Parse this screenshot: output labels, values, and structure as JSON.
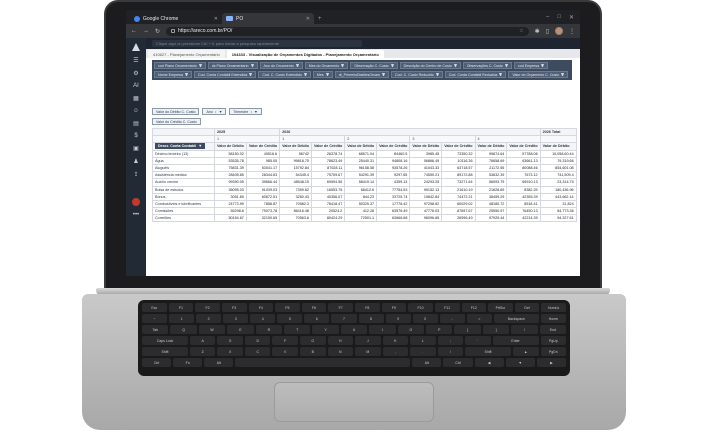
{
  "browser": {
    "tabs": [
      {
        "label": "Google Chrome"
      },
      {
        "label": "PO"
      }
    ],
    "url": "https://areco.com.br/PO/"
  },
  "app": {
    "search_placeholder": "Clique aqui ou pressione Ctrl + K para iniciar a pesquisa rapidamente",
    "crumbs": [
      {
        "label": "410627 - Planejamento Orçamentário"
      },
      {
        "label": "104333 - Visualização de Orçamentos Digitados - Planejamento Orçamentário"
      }
    ],
    "filter_fields": [
      "cod Plano Orcamentario",
      "ds Plano Orcamentario",
      "Ano do Orcamento",
      "Mes do Orcamento",
      "Observação C. Custo",
      "Descrição do Centro de Custo",
      "Observações C. Custo",
      "cod Empresa",
      "Nome Empresa",
      "Cod. Conta Contábil Extendida",
      "Cod. C. Custo Extendido",
      "Mes",
      "dt_PrimeiroDiaMesOrcam",
      "Cod. C. Custo Reduzido",
      "Cod. Conta Contábil Reduzida",
      "Valor do Orçamento C. Custo"
    ],
    "data_fields": [
      "Valor do Débito C. Custo",
      "Valor do Crédito C. Custo"
    ],
    "col_fields": [
      "Ano",
      "Trimestre"
    ],
    "row_field": "Descr. Conta Contabil",
    "years": [
      "2025",
      "2026"
    ],
    "grand_total": "2026 Total",
    "quarters": [
      "1",
      "1",
      "2",
      "3",
      "4"
    ],
    "measure_debit": "Valor de Débito",
    "measure_credit": "Valor de Crédito",
    "rows": [
      {
        "label": "Décimo terceiro (13)",
        "values": [
          "58150.02",
          "40516.6",
          "56742",
          "26378.74",
          "68571.04",
          "84460.5",
          "3985.45",
          "73350.32",
          "99874.64",
          "57788.06",
          "10,058.60.44"
        ]
      },
      {
        "label": "Água",
        "values": [
          "53535.78",
          "985.05",
          "99818.75",
          "78623.49",
          "25440.31",
          "94808.16",
          "06866.49",
          "10116.36",
          "76658.69",
          "63661.13",
          "79,319.66"
        ]
      },
      {
        "label": "Aluguéis",
        "values": [
          "75831.39",
          "53041.17",
          "15792.84",
          "87028.11",
          "96158.58",
          "93578.26",
          "41043.33",
          "63718.57",
          "21172.55",
          "80088.46",
          "854,601.08"
        ]
      },
      {
        "label": "Assistência médica",
        "values": [
          "28405.85",
          "28344.63",
          "54345.4",
          "75709.67",
          "54291.39",
          "9297.65",
          "74550.21",
          "89172.88",
          "53632.39",
          "7673.12",
          "741,509.4"
        ]
      },
      {
        "label": "Auxílio creche",
        "values": [
          "99390.05",
          "39666.44",
          "48548.15",
          "69594.56",
          "58419.14",
          "4359.13",
          "24293.25",
          "73271.64",
          "56093.79",
          "65910.13",
          "23,314.75"
        ]
      },
      {
        "label": "Bolsa de estudos",
        "values": [
          "36095.03",
          "91039.03",
          "7359.62",
          "16553.75",
          "68412.6",
          "77754.53",
          "99152.13",
          "21610.19",
          "21628.69",
          "8382.25",
          "180,436.96"
        ]
      },
      {
        "label": "Bônus",
        "values": [
          "3051.69",
          "60672.51",
          "3260.43",
          "40356.07",
          "844.23",
          "33725.74",
          "10842.84",
          "74472.21",
          "38459.29",
          "42355.39",
          "443,662.14"
        ]
      },
      {
        "label": "Combustíveis e lubrificantes",
        "values": [
          "24773.99",
          "7858.87",
          "70582.3",
          "78418.47",
          "50325.37",
          "17778.42",
          "97258.62",
          "60029.02",
          "48180.72",
          "8518.41",
          "31,824"
        ]
      },
      {
        "label": "Comissões",
        "values": [
          "55298.8",
          "79073.78",
          "86416.48",
          "20524.2",
          "412.28",
          "63576.49",
          "47776.03",
          "87697.67",
          "25550.97",
          "76450.13",
          "64,773.36"
        ]
      },
      {
        "label": "Correiões",
        "values": [
          "50154.67",
          "32150.65",
          "70563.6",
          "80424.29",
          "72501.1",
          "63666.68",
          "96096.65",
          "26596.49",
          "97920.44",
          "42214.39",
          "94,327.61"
        ]
      }
    ]
  },
  "keyboard": {
    "rows": [
      [
        "Esc",
        "F1",
        "F2",
        "F3",
        "F4",
        "F5",
        "F6",
        "F7",
        "F8",
        "F9",
        "F10",
        "F11",
        "F12",
        "PrtScr",
        "Del",
        "NumLk"
      ],
      [
        "~",
        "1",
        "2",
        "3",
        "4",
        "5",
        "6",
        "7",
        "8",
        "9",
        "0",
        "-",
        "=",
        "Backspace",
        "Home"
      ],
      [
        "Tab",
        "Q",
        "W",
        "E",
        "R",
        "T",
        "Y",
        "U",
        "I",
        "O",
        "P",
        "[",
        "]",
        "\\",
        "End"
      ],
      [
        "Caps Lock",
        "A",
        "S",
        "D",
        "F",
        "G",
        "H",
        "J",
        "K",
        "L",
        ";",
        "'",
        "Enter",
        "PgUp"
      ],
      [
        "Shift",
        "Z",
        "X",
        "C",
        "V",
        "B",
        "N",
        "M",
        ",",
        ".",
        "/",
        "Shift",
        "▲",
        "PgDn"
      ],
      [
        "Ctrl",
        "Fn",
        "Alt",
        "",
        "Alt",
        "Ctrl",
        "◀",
        "▼",
        "▶"
      ]
    ]
  }
}
